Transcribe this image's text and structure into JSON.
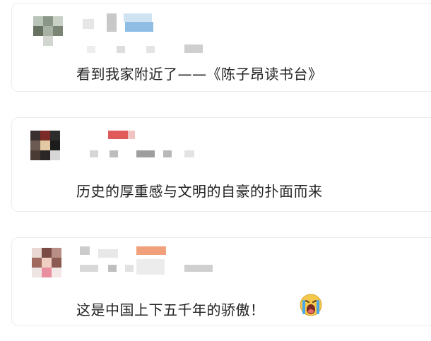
{
  "comments": [
    {
      "text": "看到我家附近了——《陈子昂读书台》"
    },
    {
      "text": "历史的厚重感与文明的自豪的扑面而来"
    },
    {
      "text": "这是中国上下五千年的骄傲！",
      "emoji": "crying-face-emoji"
    }
  ],
  "colors": {
    "background": "#ffffff",
    "card_border": "#ececec",
    "text": "#222222"
  }
}
